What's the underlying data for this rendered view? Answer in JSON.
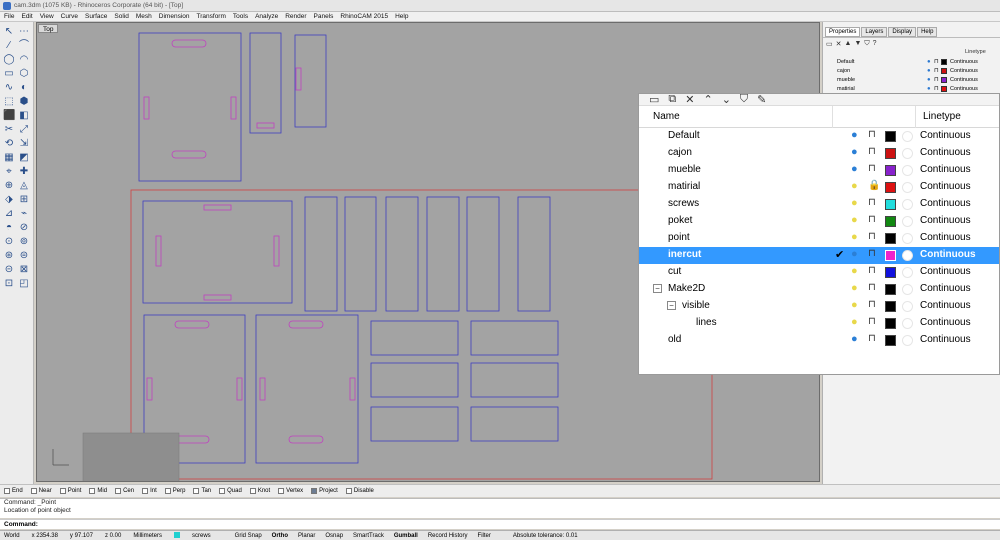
{
  "window": {
    "title": "cam.3dm (1075 KB) - Rhinoceros Corporate (64 bit) - [Top]"
  },
  "menu": [
    "File",
    "Edit",
    "View",
    "Curve",
    "Surface",
    "Solid",
    "Mesh",
    "Dimension",
    "Transform",
    "Tools",
    "Analyze",
    "Render",
    "Panels",
    "RhinoCAM 2015",
    "Help"
  ],
  "viewport": {
    "label": "Top"
  },
  "panel": {
    "tabs": [
      "Properties",
      "Layers",
      "Display",
      "Help"
    ],
    "small_header_linetype": "Linetype",
    "small_layers": [
      {
        "name": "Default",
        "color": "#000000",
        "linetype": "Continuous"
      },
      {
        "name": "cajon",
        "color": "#cc1111",
        "linetype": "Continuous"
      },
      {
        "name": "mueble",
        "color": "#8822cc",
        "linetype": "Continuous"
      },
      {
        "name": "matirial",
        "color": "#dd1111",
        "linetype": "Continuous"
      }
    ]
  },
  "layers": {
    "header_name": "Name",
    "header_linetype": "Linetype",
    "rows": [
      {
        "name": "Default",
        "indent": 0,
        "bulb": "blue",
        "locked": false,
        "color": "#000000",
        "linetype": "Continuous",
        "selected": false,
        "expander": ""
      },
      {
        "name": "cajon",
        "indent": 0,
        "bulb": "blue",
        "locked": false,
        "color": "#cc1111",
        "linetype": "Continuous",
        "selected": false,
        "expander": ""
      },
      {
        "name": "mueble",
        "indent": 0,
        "bulb": "blue",
        "locked": false,
        "color": "#8822cc",
        "linetype": "Continuous",
        "selected": false,
        "expander": ""
      },
      {
        "name": "matirial",
        "indent": 0,
        "bulb": "yellow",
        "locked": true,
        "color": "#dd1111",
        "linetype": "Continuous",
        "selected": false,
        "expander": ""
      },
      {
        "name": "screws",
        "indent": 0,
        "bulb": "yellow",
        "locked": false,
        "color": "#22dddd",
        "linetype": "Continuous",
        "selected": false,
        "expander": ""
      },
      {
        "name": "poket",
        "indent": 0,
        "bulb": "yellow",
        "locked": false,
        "color": "#118811",
        "linetype": "Continuous",
        "selected": false,
        "expander": ""
      },
      {
        "name": "point",
        "indent": 0,
        "bulb": "yellow",
        "locked": false,
        "color": "#000000",
        "linetype": "Continuous",
        "selected": false,
        "expander": ""
      },
      {
        "name": "inercut",
        "indent": 0,
        "bulb": "blue",
        "locked": false,
        "color": "#ee22cc",
        "linetype": "Continuous",
        "selected": true,
        "expander": "",
        "check": "✔"
      },
      {
        "name": "cut",
        "indent": 0,
        "bulb": "yellow",
        "locked": false,
        "color": "#1111dd",
        "linetype": "Continuous",
        "selected": false,
        "expander": ""
      },
      {
        "name": "Make2D",
        "indent": 0,
        "bulb": "yellow",
        "locked": false,
        "color": "#000000",
        "linetype": "Continuous",
        "selected": false,
        "expander": "−"
      },
      {
        "name": "visible",
        "indent": 1,
        "bulb": "yellow",
        "locked": false,
        "color": "#000000",
        "linetype": "Continuous",
        "selected": false,
        "expander": "−"
      },
      {
        "name": "lines",
        "indent": 2,
        "bulb": "yellow",
        "locked": false,
        "color": "#000000",
        "linetype": "Continuous",
        "selected": false,
        "expander": ""
      },
      {
        "name": "old",
        "indent": 0,
        "bulb": "blue",
        "locked": false,
        "color": "#000000",
        "linetype": "Continuous",
        "selected": false,
        "expander": ""
      }
    ]
  },
  "osnap": [
    {
      "label": "End",
      "on": false
    },
    {
      "label": "Near",
      "on": false
    },
    {
      "label": "Point",
      "on": false
    },
    {
      "label": "Mid",
      "on": false
    },
    {
      "label": "Cen",
      "on": false
    },
    {
      "label": "Int",
      "on": false
    },
    {
      "label": "Perp",
      "on": false
    },
    {
      "label": "Tan",
      "on": false
    },
    {
      "label": "Quad",
      "on": false
    },
    {
      "label": "Knot",
      "on": false
    },
    {
      "label": "Vertex",
      "on": false
    },
    {
      "label": "Project",
      "on": true
    },
    {
      "label": "Disable",
      "on": false
    }
  ],
  "command": {
    "history_1": "Command: _Point",
    "history_2": "Location of point object",
    "prompt": "Command:"
  },
  "status": {
    "cplane": "World",
    "x": "x 2354.38",
    "y": "y 97.107",
    "z": "z 0.00",
    "units": "Millimeters",
    "layer": "screws",
    "buttons": [
      "Grid Snap",
      "Ortho",
      "Planar",
      "Osnap",
      "SmartTrack",
      "Gumball",
      "Record History",
      "Filter"
    ],
    "tolerance": "Absolute tolerance: 0.01"
  }
}
